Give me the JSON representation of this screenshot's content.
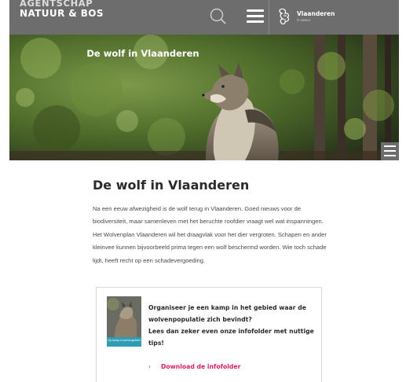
{
  "header": {
    "brand_line1": "AGENTSCHAP",
    "brand_line2": "NATUUR & BOS",
    "search_icon": "search-icon",
    "menu_icon": "hamburger-menu-icon",
    "vlaanderen_label": "Vlaanderen",
    "vlaanderen_sub": "is natuur",
    "background": "#6d6d6d"
  },
  "hero": {
    "title": "De wolf in Vlaanderen",
    "image": "wolf-in-forest-photo",
    "menu_icon": "hamburger-menu-icon"
  },
  "main": {
    "title": "De wolf in Vlaanderen",
    "intro": "Na een eeuw afwezigheid is de wolf terug in Vlaanderen. Goed nieuws voor de biodiversiteit, maar samenleven met het beruchte roofdier vraagt wel wat inspanningen. Het Wolvenplan Vlaanderen wil het draagvlak voor het dier vergroten. Schapen en ander kleinvee kunnen bijvoorbeeld prima tegen een wolf beschermd worden. Wie toch schade lijdt, heeft recht op een schadevergoeding."
  },
  "promo": {
    "cover_label": "Op kamp in wolvengebied",
    "text_line1": "Organiseer je een kamp in het gebied waar de wolvenpopulatie zich bevindt?",
    "text_line2": "Lees dan zeker even onze infofolder met nuttige tips!",
    "link_chevron": "›",
    "link_label": "Download de infofolder",
    "link_color": "#d81d66"
  }
}
